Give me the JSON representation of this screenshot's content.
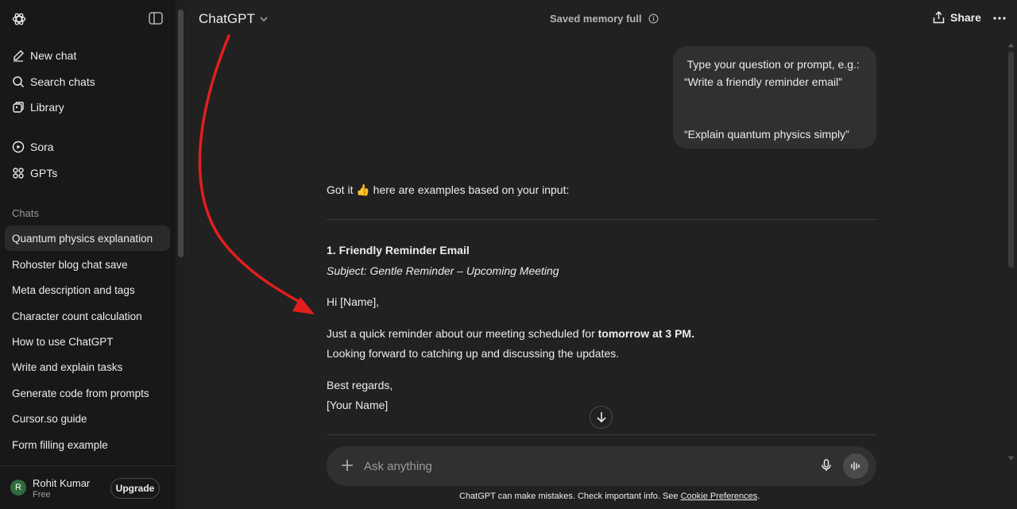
{
  "sidebar": {
    "new_chat": "New chat",
    "search_chats": "Search chats",
    "library": "Library",
    "sora": "Sora",
    "gpts": "GPTs",
    "section_title": "Chats",
    "chats": [
      "Quantum physics explanation",
      "Rohoster blog chat save",
      "Meta description and tags",
      "Character count calculation",
      "How to use ChatGPT",
      "Write and explain tasks",
      "Generate code from prompts",
      "Cursor.so guide",
      "Form filling example"
    ],
    "user": {
      "initial": "R",
      "name": "Rohit Kumar",
      "plan": "Free",
      "upgrade": "Upgrade"
    }
  },
  "header": {
    "model": "ChatGPT",
    "memory": "Saved memory full",
    "share": "Share"
  },
  "conversation": {
    "user_message": [
      " Type your question or prompt, e.g.:",
      "“Write a friendly reminder email”",
      "",
      "",
      "“Explain quantum physics simply”"
    ],
    "assistant": {
      "intro": "Got it 👍 here are examples based on your input:",
      "heading": "1. Friendly Reminder Email",
      "subject": "Subject: Gentle Reminder – Upcoming Meeting",
      "greeting": "Hi [Name],",
      "body_pre": "Just a quick reminder about our meeting scheduled for ",
      "body_bold": "tomorrow at 3 PM.",
      "body_line2": "Looking forward to catching up and discussing the updates.",
      "signoff": "Best regards,",
      "signature": "[Your Name]"
    }
  },
  "composer": {
    "placeholder": "Ask anything"
  },
  "footer": {
    "disclaimer": "ChatGPT can make mistakes. Check important info. See ",
    "link": "Cookie Preferences",
    "end": "."
  },
  "colors": {
    "background": "#212121",
    "sidebar": "#181818",
    "bubble": "#303030",
    "annotation_arrow": "#e31e1e"
  }
}
